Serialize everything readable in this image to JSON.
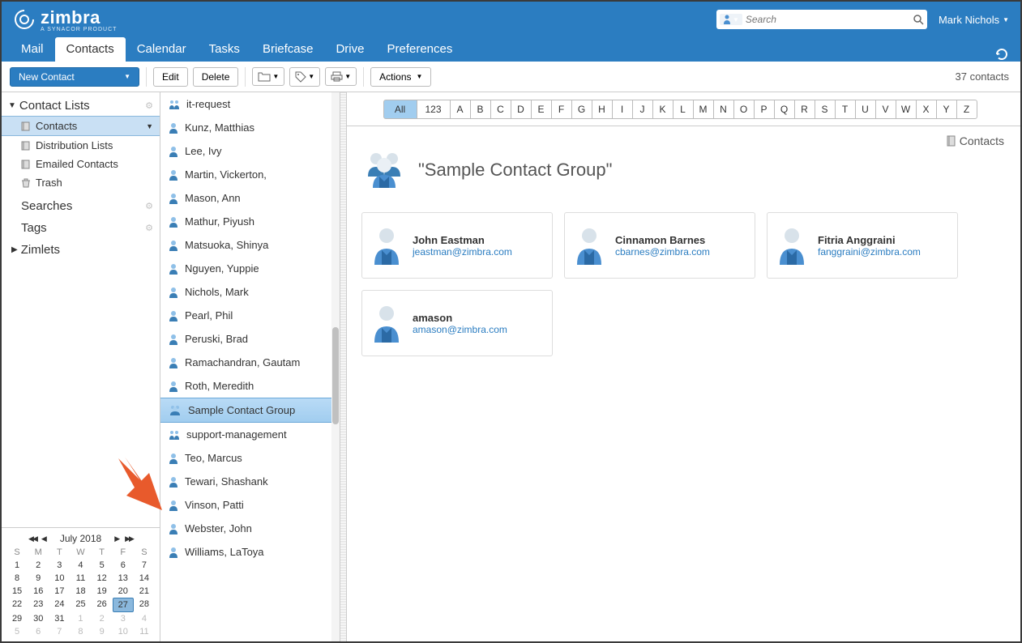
{
  "brand": {
    "name": "zimbra",
    "tagline": "A SYNACOR PRODUCT"
  },
  "search": {
    "placeholder": "Search"
  },
  "user": {
    "name": "Mark Nichols"
  },
  "tabs": [
    "Mail",
    "Contacts",
    "Calendar",
    "Tasks",
    "Briefcase",
    "Drive",
    "Preferences"
  ],
  "active_tab": 1,
  "toolbar": {
    "new_contact": "New Contact",
    "edit": "Edit",
    "delete": "Delete",
    "actions": "Actions"
  },
  "count_label": "37 contacts",
  "sidebar": {
    "header": "Contact Lists",
    "items": [
      {
        "label": "Contacts",
        "selected": true,
        "icon": "book"
      },
      {
        "label": "Distribution Lists",
        "icon": "book"
      },
      {
        "label": "Emailed Contacts",
        "icon": "book"
      },
      {
        "label": "Trash",
        "icon": "trash"
      }
    ],
    "sections": [
      "Searches",
      "Tags",
      "Zimlets"
    ]
  },
  "calendar": {
    "title": "July 2018",
    "dow": [
      "S",
      "M",
      "T",
      "W",
      "T",
      "F",
      "S"
    ],
    "weeks": [
      [
        {
          "d": 1
        },
        {
          "d": 2
        },
        {
          "d": 3
        },
        {
          "d": 4
        },
        {
          "d": 5
        },
        {
          "d": 6
        },
        {
          "d": 7
        }
      ],
      [
        {
          "d": 8
        },
        {
          "d": 9
        },
        {
          "d": 10
        },
        {
          "d": 11
        },
        {
          "d": 12
        },
        {
          "d": 13
        },
        {
          "d": 14
        }
      ],
      [
        {
          "d": 15
        },
        {
          "d": 16
        },
        {
          "d": 17
        },
        {
          "d": 18
        },
        {
          "d": 19
        },
        {
          "d": 20
        },
        {
          "d": 21
        }
      ],
      [
        {
          "d": 22
        },
        {
          "d": 23
        },
        {
          "d": 24
        },
        {
          "d": 25
        },
        {
          "d": 26
        },
        {
          "d": 27,
          "today": true
        },
        {
          "d": 28
        }
      ],
      [
        {
          "d": 29
        },
        {
          "d": 30
        },
        {
          "d": 31
        },
        {
          "d": 1,
          "om": true
        },
        {
          "d": 2,
          "om": true
        },
        {
          "d": 3,
          "om": true
        },
        {
          "d": 4,
          "om": true
        }
      ],
      [
        {
          "d": 5,
          "om": true
        },
        {
          "d": 6,
          "om": true
        },
        {
          "d": 7,
          "om": true
        },
        {
          "d": 8,
          "om": true
        },
        {
          "d": 9,
          "om": true
        },
        {
          "d": 10,
          "om": true
        },
        {
          "d": 11,
          "om": true
        }
      ]
    ]
  },
  "contact_list": [
    {
      "label": "it-request",
      "type": "dl"
    },
    {
      "label": "Kunz, Matthias",
      "type": "person"
    },
    {
      "label": "Lee, Ivy",
      "type": "person"
    },
    {
      "label": "Martin, Vickerton,",
      "type": "person"
    },
    {
      "label": "Mason, Ann",
      "type": "person"
    },
    {
      "label": "Mathur, Piyush",
      "type": "person"
    },
    {
      "label": "Matsuoka, Shinya",
      "type": "person"
    },
    {
      "label": "Nguyen, Yuppie",
      "type": "person"
    },
    {
      "label": "Nichols, Mark",
      "type": "person"
    },
    {
      "label": "Pearl, Phil",
      "type": "person"
    },
    {
      "label": "Peruski, Brad",
      "type": "person"
    },
    {
      "label": "Ramachandran, Gautam",
      "type": "person"
    },
    {
      "label": "Roth, Meredith",
      "type": "person"
    },
    {
      "label": "Sample Contact Group",
      "type": "group",
      "selected": true
    },
    {
      "label": "support-management",
      "type": "dl"
    },
    {
      "label": "Teo, Marcus",
      "type": "person"
    },
    {
      "label": "Tewari, Shashank",
      "type": "person"
    },
    {
      "label": "Vinson, Patti",
      "type": "person"
    },
    {
      "label": "Webster, John",
      "type": "person"
    },
    {
      "label": "Williams, LaToya",
      "type": "person"
    }
  ],
  "alpha": {
    "all": "All",
    "num": "123",
    "letters": [
      "A",
      "B",
      "C",
      "D",
      "E",
      "F",
      "G",
      "H",
      "I",
      "J",
      "K",
      "L",
      "M",
      "N",
      "O",
      "P",
      "Q",
      "R",
      "S",
      "T",
      "U",
      "V",
      "W",
      "X",
      "Y",
      "Z"
    ]
  },
  "detail": {
    "title": "\"Sample Contact Group\"",
    "location": "Contacts",
    "members": [
      {
        "name": "John Eastman",
        "email": "jeastman@zimbra.com"
      },
      {
        "name": "Cinnamon Barnes",
        "email": "cbarnes@zimbra.com"
      },
      {
        "name": "Fitria Anggraini",
        "email": "fanggraini@zimbra.com"
      },
      {
        "name": "amason",
        "email": "amason@zimbra.com"
      }
    ]
  }
}
